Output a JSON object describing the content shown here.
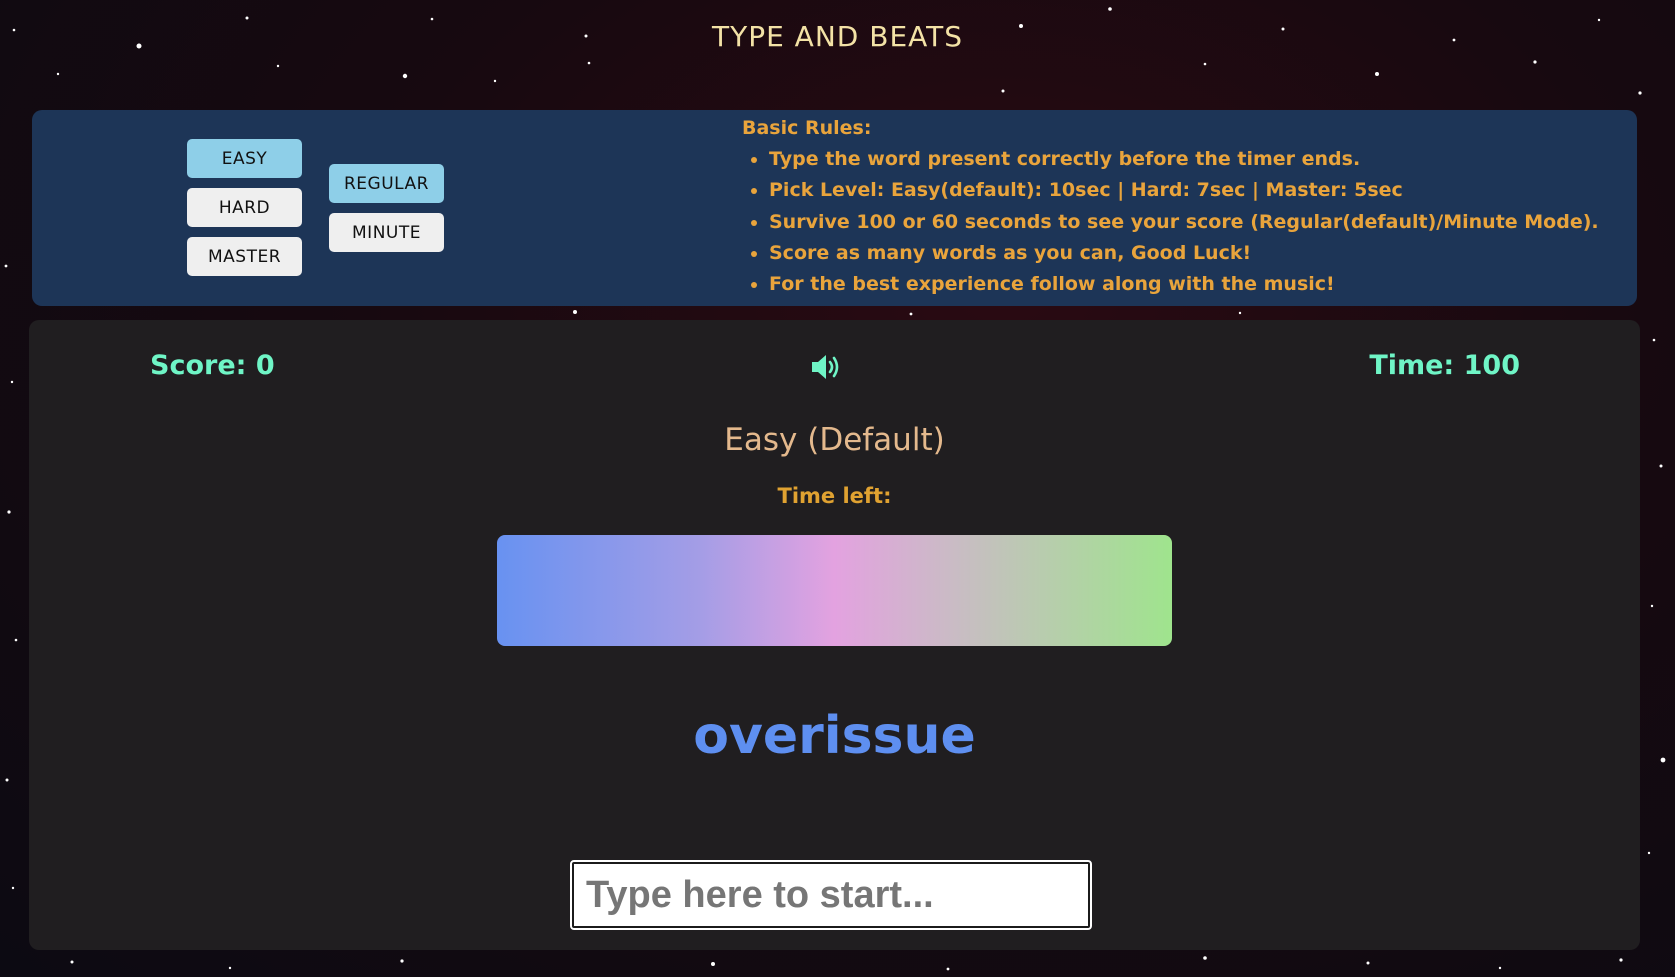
{
  "header": {
    "title": "TYPE AND BEATS"
  },
  "levels": {
    "easy": "EASY",
    "hard": "HARD",
    "master": "MASTER",
    "regular": "REGULAR",
    "minute": "MINUTE",
    "active_difficulty": "EASY",
    "active_mode": "REGULAR"
  },
  "rules": {
    "heading": "Basic Rules:",
    "items": [
      "Type the word present correctly before the timer ends.",
      "Pick Level: Easy(default): 10sec | Hard: 7sec | Master: 5sec",
      "Survive 100 or 60 seconds to see your score (Regular(default)/Minute Mode).",
      "Score as many words as you can, Good Luck!",
      "For the best experience follow along with the music!"
    ]
  },
  "game": {
    "score_label": "Score: 0",
    "time_label": "Time: 100",
    "sound_icon": "volume-on-icon",
    "mode_heading": "Easy (Default)",
    "time_left_label": "Time left:",
    "timer_fraction": 1.0,
    "current_word": "overissue",
    "input_placeholder": "Type here to start...",
    "input_value": ""
  },
  "colors": {
    "title": "#f3e2a6",
    "rules_panel_bg": "#1d3557",
    "rules_text": "#e9a43c",
    "game_panel_bg": "#201e20",
    "score_time": "#6ff5c6",
    "word": "#5e8ff0",
    "active_button": "#8ecfe8"
  }
}
